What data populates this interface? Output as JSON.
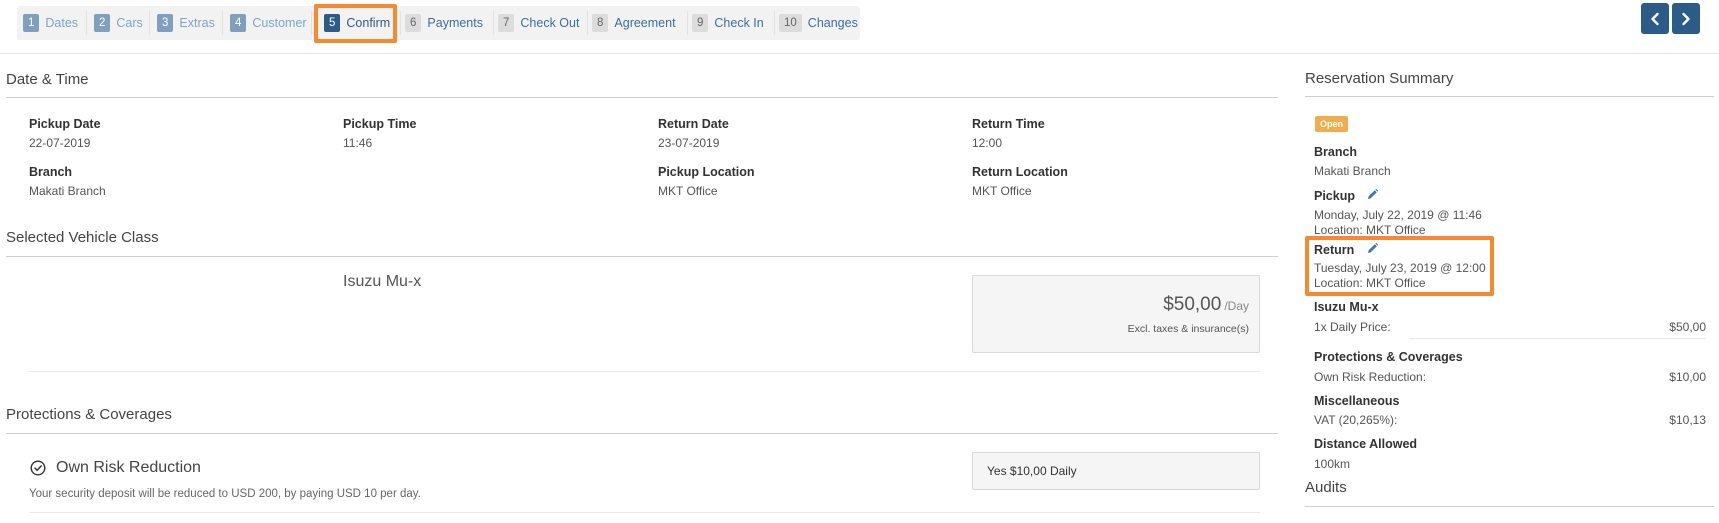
{
  "steps": [
    {
      "num": "1",
      "label": "Dates",
      "state": "done"
    },
    {
      "num": "2",
      "label": "Cars",
      "state": "done"
    },
    {
      "num": "3",
      "label": "Extras",
      "state": "done"
    },
    {
      "num": "4",
      "label": "Customer",
      "state": "done"
    },
    {
      "num": "5",
      "label": "Confirm",
      "state": "active"
    },
    {
      "num": "6",
      "label": "Payments",
      "state": "todo"
    },
    {
      "num": "7",
      "label": "Check Out",
      "state": "todo"
    },
    {
      "num": "8",
      "label": "Agreement",
      "state": "todo"
    },
    {
      "num": "9",
      "label": "Check In",
      "state": "todo"
    },
    {
      "num": "10",
      "label": "Changes",
      "state": "todo"
    }
  ],
  "nav": {
    "prev_icon": "chevron-left-icon",
    "next_icon": "chevron-right-icon"
  },
  "date_time": {
    "title": "Date & Time",
    "pickup_date_label": "Pickup Date",
    "pickup_date": "22-07-2019",
    "pickup_time_label": "Pickup Time",
    "pickup_time": "11:46",
    "return_date_label": "Return Date",
    "return_date": "23-07-2019",
    "return_time_label": "Return Time",
    "return_time": "12:00",
    "branch_label": "Branch",
    "branch": "Makati Branch",
    "pickup_location_label": "Pickup Location",
    "pickup_location": "MKT Office",
    "return_location_label": "Return Location",
    "return_location": "MKT Office"
  },
  "vehicle": {
    "title": "Selected Vehicle Class",
    "name": "Isuzu Mu-x",
    "price": "$50,00",
    "per": "/Day",
    "note": "Excl. taxes & insurance(s)"
  },
  "coverages": {
    "title": "Protections & Coverages",
    "item_name": "Own Risk Reduction",
    "item_desc": "Your security deposit will be reduced to USD 200, by paying USD 10 per day.",
    "selected": "Yes $10,00 Daily"
  },
  "summary": {
    "title": "Reservation Summary",
    "status": "Open",
    "branch_label": "Branch",
    "branch": "Makati Branch",
    "pickup_label": "Pickup",
    "pickup_datetime": "Monday, July 22, 2019 @ 11:46",
    "pickup_location": "Location: MKT Office",
    "return_label": "Return",
    "return_datetime": "Tuesday, July 23, 2019 @ 12:00",
    "return_location": "Location: MKT Office",
    "vehicle_label": "Isuzu Mu-x",
    "daily_price_label": "1x Daily Price:",
    "daily_price": "$50,00",
    "protections_label": "Protections & Coverages",
    "orr_label": "Own Risk Reduction:",
    "orr_amount": "$10,00",
    "misc_label": "Miscellaneous",
    "vat_label": "VAT (20,265%):",
    "vat_amount": "$10,13",
    "distance_label": "Distance Allowed",
    "distance": "100km",
    "audits_title": "Audits"
  },
  "colors": {
    "primary": "#2d5b88",
    "highlight": "#f58a2e",
    "badge": "#f0ad4e"
  }
}
